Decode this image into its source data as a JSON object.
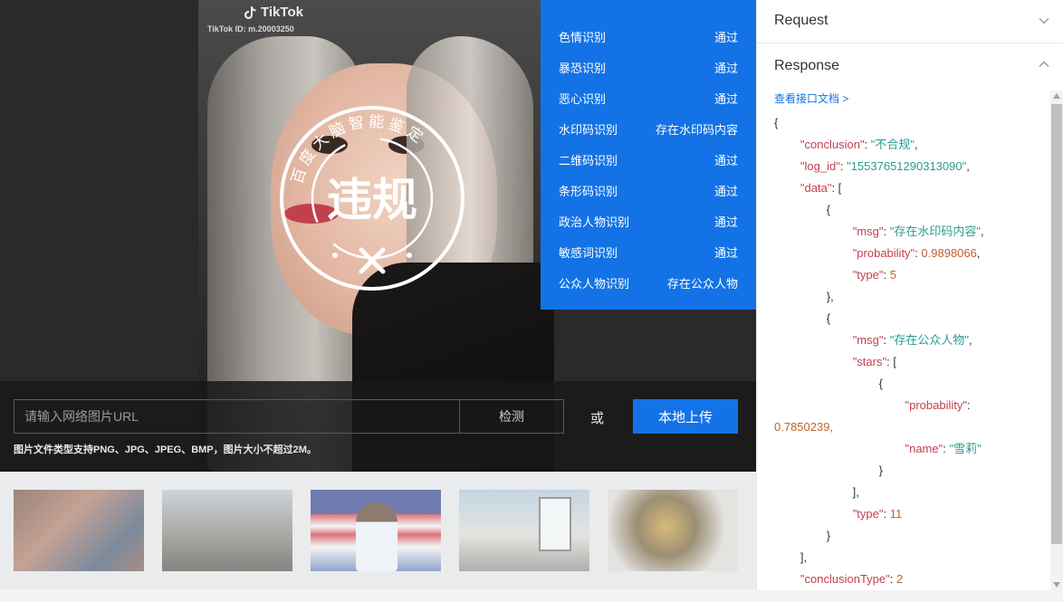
{
  "watermark": {
    "brand": "TikTok",
    "id_text": "TikTok ID: m.20003250"
  },
  "stamp": {
    "ring_text": "百度大脑智能鉴定",
    "verdict": "违规"
  },
  "results": [
    {
      "label": "色情识别",
      "status": "通过"
    },
    {
      "label": "暴恐识别",
      "status": "通过"
    },
    {
      "label": "恶心识别",
      "status": "通过"
    },
    {
      "label": "水印码识别",
      "status": "存在水印码内容"
    },
    {
      "label": "二维码识别",
      "status": "通过"
    },
    {
      "label": "条形码识别",
      "status": "通过"
    },
    {
      "label": "政治人物识别",
      "status": "通过"
    },
    {
      "label": "敏感词识别",
      "status": "通过"
    },
    {
      "label": "公众人物识别",
      "status": "存在公众人物"
    }
  ],
  "upload": {
    "url_placeholder": "请输入网络图片URL",
    "detect_label": "检测",
    "or_label": "或",
    "local_upload_label": "本地上传",
    "hint": "图片文件类型支持PNG、JPG、JPEG、BMP，图片大小不超过2M。"
  },
  "side": {
    "request_title": "Request",
    "response_title": "Response",
    "doc_link": "查看接口文档 >",
    "json": {
      "conclusion_key": "\"conclusion\"",
      "conclusion_val": "\"不合规\"",
      "log_id_key": "\"log_id\"",
      "log_id_val": "\"15537651290313090\"",
      "data_key": "\"data\"",
      "msg_key": "\"msg\"",
      "msg1_val": "\"存在水印码内容\"",
      "probability_key": "\"probability\"",
      "prob1_val": "0.9898066",
      "type_key": "\"type\"",
      "type1_val": "5",
      "msg2_val": "\"存在公众人物\"",
      "stars_key": "\"stars\"",
      "prob2_val": "0.7850239,",
      "name_key": "\"name\"",
      "name_val": "\"雪莉\"",
      "type2_val": "11",
      "conclusion_type_key": "\"conclusionType\"",
      "conclusion_type_val": "2"
    }
  },
  "colors": {
    "accent": "#1373e6",
    "json_key": "#c2404e",
    "json_string": "#2a9d8f",
    "json_number": "#c0622c"
  }
}
